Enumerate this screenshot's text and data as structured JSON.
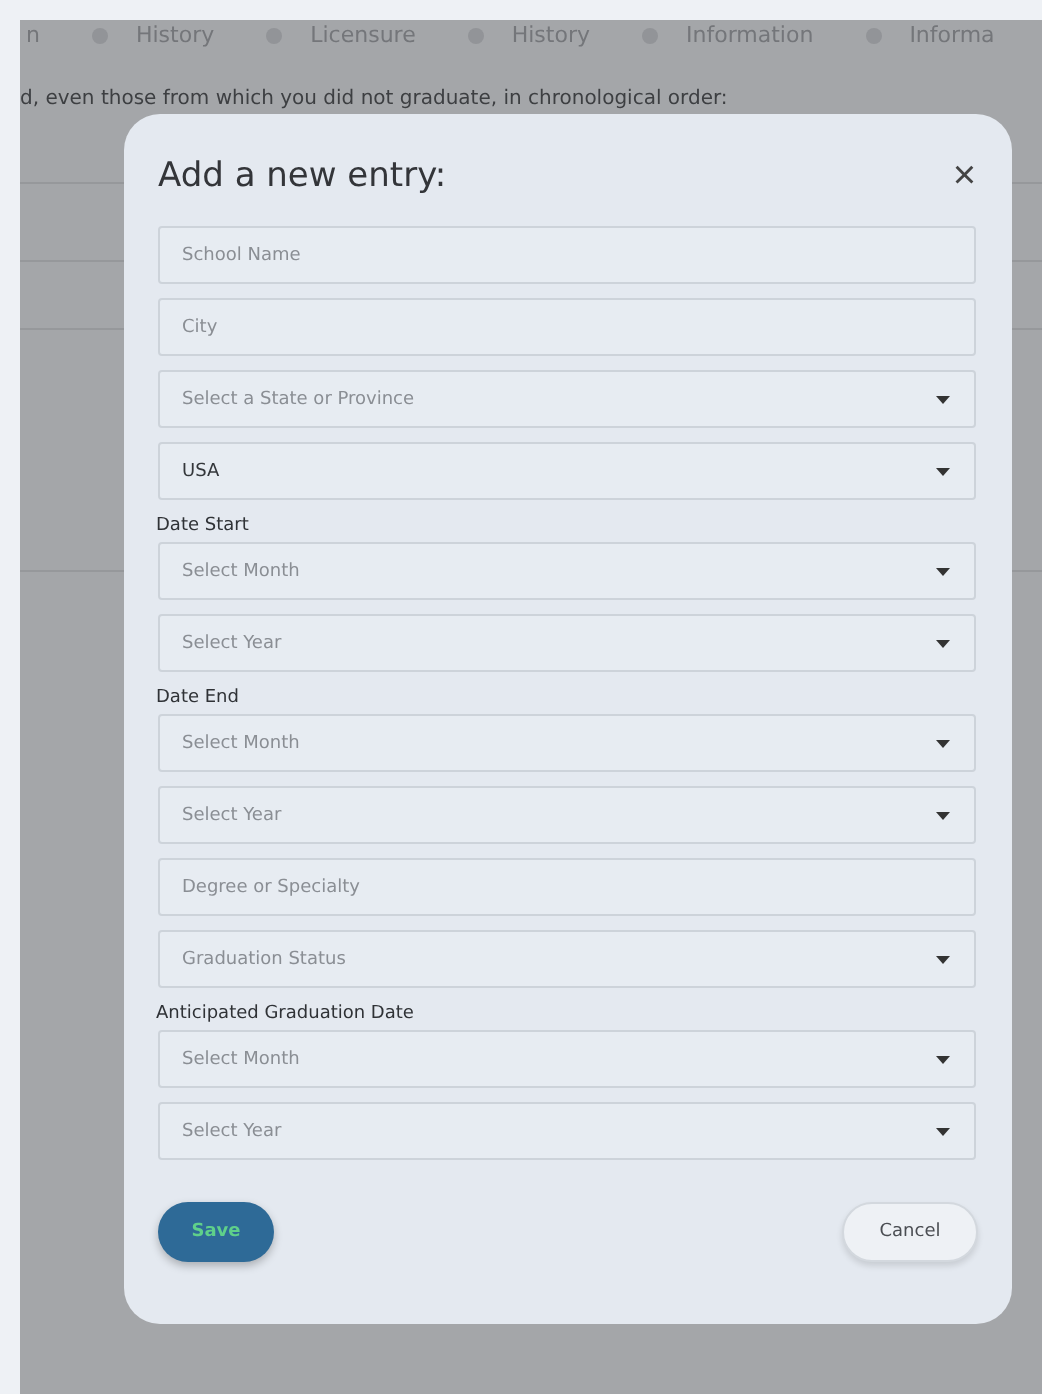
{
  "background": {
    "tabs": [
      {
        "label": "n"
      },
      {
        "label": "History"
      },
      {
        "label": "Licensure"
      },
      {
        "label": "History"
      },
      {
        "label": "Information"
      },
      {
        "label": "Informa"
      }
    ],
    "instruction": "d, even those from which you did not graduate, in chronological order:"
  },
  "dialog": {
    "title": "Add a new entry:",
    "close": "×",
    "items": [
      {
        "kind": "text",
        "placeholder": "School Name"
      },
      {
        "kind": "text",
        "placeholder": "City"
      },
      {
        "kind": "select",
        "placeholder": "Select a State or Province"
      },
      {
        "kind": "select",
        "value": "USA"
      },
      {
        "kind": "label",
        "text": "Date Start"
      },
      {
        "kind": "select",
        "placeholder": "Select Month"
      },
      {
        "kind": "select",
        "placeholder": "Select Year"
      },
      {
        "kind": "label",
        "text": "Date End"
      },
      {
        "kind": "select",
        "placeholder": "Select Month"
      },
      {
        "kind": "select",
        "placeholder": "Select Year"
      },
      {
        "kind": "text",
        "placeholder": "Degree or Specialty"
      },
      {
        "kind": "select",
        "placeholder": "Graduation Status"
      },
      {
        "kind": "label",
        "text": "Anticipated Graduation Date"
      },
      {
        "kind": "select",
        "placeholder": "Select Month"
      },
      {
        "kind": "select",
        "placeholder": "Select Year"
      }
    ],
    "save": "Save",
    "cancel": "Cancel"
  }
}
